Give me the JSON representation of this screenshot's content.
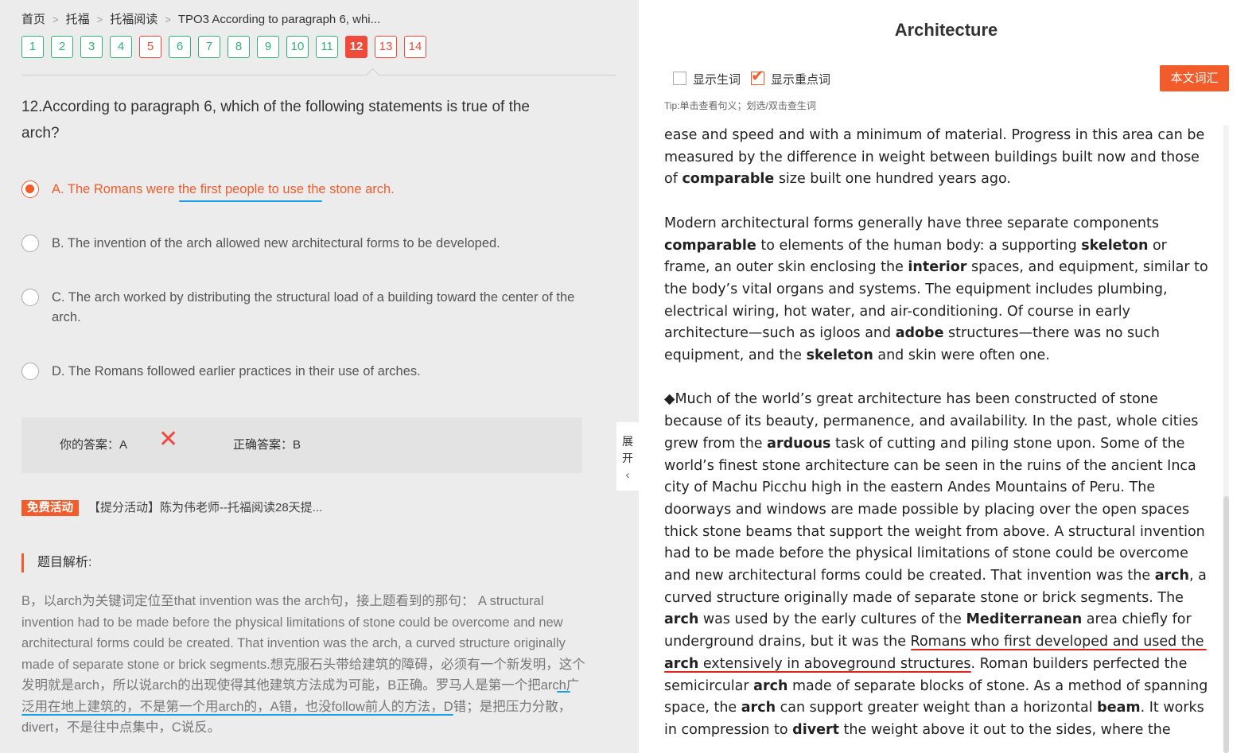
{
  "breadcrumb": [
    "首页",
    "托福",
    "托福阅读",
    "TPO3 According to paragraph 6, whi..."
  ],
  "question_numbers": [
    {
      "label": "1",
      "state": "correct"
    },
    {
      "label": "2",
      "state": "correct"
    },
    {
      "label": "3",
      "state": "correct"
    },
    {
      "label": "4",
      "state": "correct"
    },
    {
      "label": "5",
      "state": "wrong"
    },
    {
      "label": "6",
      "state": "correct"
    },
    {
      "label": "7",
      "state": "correct"
    },
    {
      "label": "8",
      "state": "correct"
    },
    {
      "label": "9",
      "state": "correct"
    },
    {
      "label": "10",
      "state": "correct"
    },
    {
      "label": "11",
      "state": "correct"
    },
    {
      "label": "12",
      "state": "active"
    },
    {
      "label": "13",
      "state": "wrong"
    },
    {
      "label": "14",
      "state": "wrong"
    }
  ],
  "question": {
    "text": "12.According to paragraph 6, which of the following statements is true of the arch?",
    "options": [
      {
        "label": "A. The Romans were the first people to use the stone arch.",
        "selected": true
      },
      {
        "label": "B. The invention of the arch allowed new architectural forms to be developed.",
        "selected": false
      },
      {
        "label": "C. The arch worked by distributing the structural load of a building toward the center of the arch.",
        "selected": false
      },
      {
        "label": "D. The Romans followed earlier practices in their use of arches.",
        "selected": false
      }
    ]
  },
  "result": {
    "your_answer": "你的答案：A",
    "correct_answer": "正确答案：B",
    "mark": "✕"
  },
  "promo": {
    "tag": "免费活动",
    "text": "【提分活动】陈为伟老师--托福阅读28天提..."
  },
  "analysis": {
    "title": "题目解析:",
    "text": "B，以arch为关键词定位至that invention was the arch句，接上题看到的那句： A structural invention had to be made before the physical limitations of stone could be overcome and new architectural forms could be created. That invention was the arch, a curved structure originally made of separate stone or brick segments.想克服石头带给建筑的障碍，必须有一个新发明，这个发明就是arch，所以说arch的出现使得其他建筑方法成为可能，B正确。罗马人是第一个把arch广泛用在地上建筑的，不是第一个用arch的，A错，也没follow前人的方法，D错；是把压力分散，divert，不是往中点集中，C说反。"
  },
  "expand_tab": {
    "line1": "展",
    "line2": "开",
    "chevron": "‹"
  },
  "right": {
    "title": "Architecture",
    "checkbox_new_words": "显示生词",
    "checkbox_key_words": "显示重点词",
    "key_words_checked": true,
    "new_words_checked": false,
    "vocab_button": "本文词汇",
    "tip": "Tip:单击查看句义；划选/双击查生词"
  },
  "passage": [
    [
      {
        "t": "ease and speed and with a minimum of material. Progress in this area can be measured by the difference in weight between buildings built now and those of "
      },
      {
        "t": "comparable",
        "b": true
      },
      {
        "t": " size built one hundred years ago."
      }
    ],
    [
      {
        "t": "Modern architectural forms generally have three separate components "
      },
      {
        "t": "comparable",
        "b": true
      },
      {
        "t": " to elements of the human body: a supporting "
      },
      {
        "t": "skeleton",
        "b": true
      },
      {
        "t": " or frame, an outer skin enclosing the "
      },
      {
        "t": "interior",
        "b": true
      },
      {
        "t": " spaces, and equipment, similar to the body’s vital organs and systems. The equipment includes plumbing, electrical wiring, hot water, and air-conditioning. Of course in early architecture—such as igloos and "
      },
      {
        "t": "adobe",
        "b": true
      },
      {
        "t": " structures—there was no such equipment, and the "
      },
      {
        "t": "skeleton",
        "b": true
      },
      {
        "t": " and skin were often one."
      }
    ],
    [
      {
        "t": "◆Much of the world’s great architecture has been constructed of stone because of its beauty, permanence, and availability. In the past, whole cities grew from the "
      },
      {
        "t": "arduous",
        "b": true
      },
      {
        "t": " task of cutting and piling stone upon. Some of the world’s finest stone architecture can be seen in the ruins of the ancient Inca city of Machu Picchu high in the eastern Andes Mountains of Peru. The doorways and windows are made possible by placing over the open spaces thick stone beams that support the weight from above. A structural invention had to be made before the physical limitations of stone could be overcome and new architectural forms could be created. That invention was the "
      },
      {
        "t": "arch",
        "b": true
      },
      {
        "t": ", a curved structure originally made of separate stone or brick segments. The "
      },
      {
        "t": "arch",
        "b": true
      },
      {
        "t": " was used by the early cultures of the "
      },
      {
        "t": "Mediterranean",
        "b": true
      },
      {
        "t": " area chiefly for underground drains, but it was the Romans who first developed and used the "
      },
      {
        "t": "arch",
        "b": true
      },
      {
        "t": " extensively in aboveground structures. Roman builders perfected the semicircular "
      },
      {
        "t": "arch",
        "b": true
      },
      {
        "t": " made of separate blocks of stone. As a method of spanning space, the "
      },
      {
        "t": "arch",
        "b": true
      },
      {
        "t": " can support greater weight than a horizontal "
      },
      {
        "t": "beam",
        "b": true
      },
      {
        "t": ". It works in compression to "
      },
      {
        "t": "divert",
        "b": true
      },
      {
        "t": " the weight above it out to the sides, where the"
      }
    ]
  ],
  "colors": {
    "accent": "#f25b2a",
    "correct": "#2fb37a",
    "wrong": "#f04a3a",
    "annotation_blue": "#1aa0e8",
    "annotation_red": "#e0231f"
  }
}
